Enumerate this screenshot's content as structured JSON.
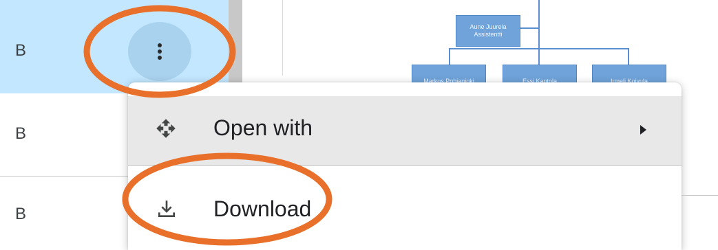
{
  "file_rows": [
    {
      "size": "B"
    },
    {
      "size": "B"
    },
    {
      "size": "B"
    }
  ],
  "org_chart": {
    "top": {
      "name": "Aune Juurela",
      "title": "Assistentti"
    },
    "children": [
      "Markus Pohjanjoki",
      "Essi Kantola",
      "Irmeli Koivula"
    ]
  },
  "context_menu": {
    "open_with": "Open with",
    "download": "Download"
  },
  "highlight_color": "#e8702a",
  "icons": {
    "more": "more-vert-icon",
    "open_with": "open-with-icon",
    "download": "download-icon",
    "submenu": "arrow-right-icon"
  }
}
